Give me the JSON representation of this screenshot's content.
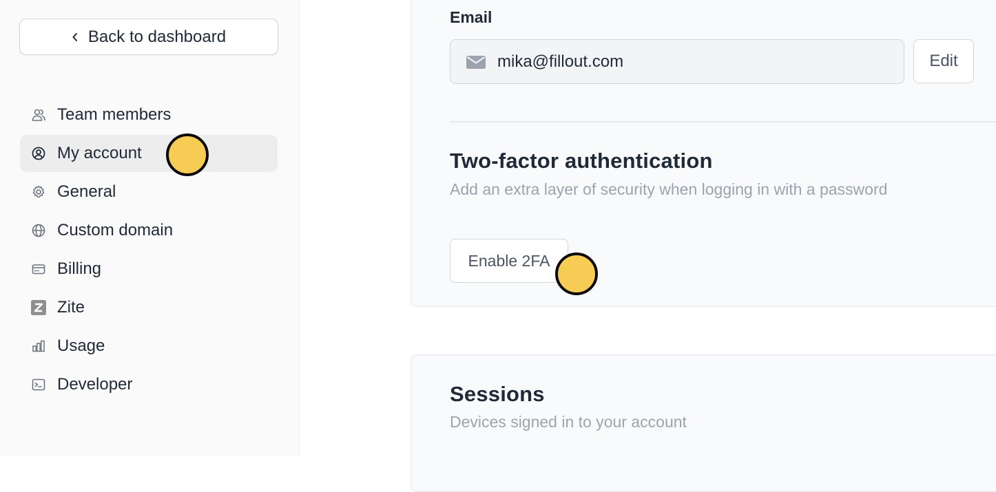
{
  "sidebar": {
    "back_label": "Back to dashboard",
    "items": [
      {
        "label": "Team members",
        "icon": "users-icon"
      },
      {
        "label": "My account",
        "icon": "user-circle-icon",
        "active": true
      },
      {
        "label": "General",
        "icon": "gear-icon"
      },
      {
        "label": "Custom domain",
        "icon": "globe-icon"
      },
      {
        "label": "Billing",
        "icon": "credit-card-icon"
      },
      {
        "label": "Zite",
        "icon": "zite-logo-icon"
      },
      {
        "label": "Usage",
        "icon": "bar-chart-icon"
      },
      {
        "label": "Developer",
        "icon": "terminal-icon"
      }
    ]
  },
  "account": {
    "email_label": "Email",
    "email_value": "mika@fillout.com",
    "edit_label": "Edit"
  },
  "two_factor": {
    "title": "Two-factor authentication",
    "subtitle": "Add an extra layer of security when logging in with a password",
    "button_label": "Enable 2FA"
  },
  "sessions": {
    "title": "Sessions",
    "subtitle": "Devices signed in to your account"
  },
  "colors": {
    "marker": "#f7cc55",
    "active_bg": "#ededee",
    "muted_text": "#9ca3af"
  }
}
